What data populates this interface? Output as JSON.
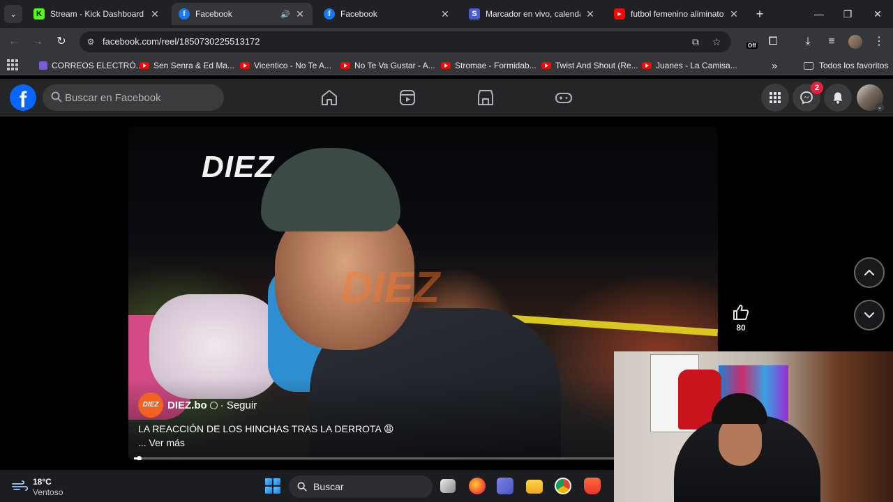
{
  "browser": {
    "tabs": [
      {
        "title": "Stream - Kick Dashboard",
        "favicon": "kick-icon",
        "active": false
      },
      {
        "title": "Facebook",
        "favicon": "facebook-icon",
        "active": true,
        "audio": true
      },
      {
        "title": "Facebook",
        "favicon": "facebook-icon",
        "active": false
      },
      {
        "title": "Marcador en vivo, calendario",
        "favicon": "scoreboard-icon",
        "active": false
      },
      {
        "title": "futbol femenino aliminatorias",
        "favicon": "youtube-icon",
        "active": false
      }
    ],
    "url": "facebook.com/reel/1850730225513172",
    "extension_badge": "Off",
    "bookmarks": [
      {
        "label": "CORREOS ELECTRÓ...",
        "icon": "mail-icon"
      },
      {
        "label": "Sen Senra & Ed Ma...",
        "icon": "youtube-icon"
      },
      {
        "label": "Vicentico - No Te A...",
        "icon": "youtube-icon"
      },
      {
        "label": "No Te Va Gustar - A...",
        "icon": "youtube-icon"
      },
      {
        "label": "Stromae - Formidab...",
        "icon": "youtube-icon"
      },
      {
        "label": "Twist And Shout (Re...",
        "icon": "youtube-icon"
      },
      {
        "label": "Juanes - La Camisa...",
        "icon": "youtube-icon"
      }
    ],
    "bookmarks_overflow": "»",
    "all_bookmarks": "Todos los favoritos"
  },
  "facebook": {
    "logo": "f",
    "search_placeholder": "Buscar en Facebook",
    "messenger_badge": "2",
    "colors": {
      "brand": "#0866ff",
      "badge": "#e41e3f"
    }
  },
  "reel": {
    "brand_logo": "DIEZ",
    "watermark": "DIEZ",
    "author": "DIEZ.bo",
    "author_avatar_text": "DIEZ",
    "follow": "· Seguir",
    "caption": "LA REACCIÓN DE LOS HINCHAS TRAS LA DERROTA 😩",
    "see_more": "... Ver más",
    "like_count": "80",
    "progress": 0.01
  },
  "taskbar": {
    "temperature": "18°C",
    "weather": "Ventoso",
    "search_placeholder": "Buscar"
  }
}
